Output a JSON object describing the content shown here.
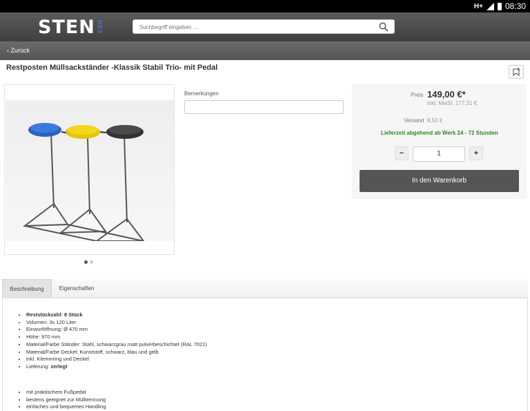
{
  "statusbar": {
    "network": "H+",
    "time": "08:30"
  },
  "header": {
    "logo": "STEN",
    "logo_sub": "HGS",
    "search_placeholder": "Suchbegriff eingeben ..."
  },
  "nav": {
    "back_label": "Zurück"
  },
  "product": {
    "title": "Restposten Müllsackständer -Klassik Stabil Trio- mit Pedal"
  },
  "form": {
    "remarks_label": "Bemerkungen",
    "remarks_value": ""
  },
  "buy": {
    "price_label": "Preis",
    "price": "149,00 €*",
    "price_net": "inkl. MwSt. 177,31 €",
    "shipping_label": "Versand",
    "shipping": "8,50 €",
    "delivery": "Lieferzeit abgehend ab Werk 24 - 72 Stunden",
    "minus": "−",
    "quantity": "1",
    "plus": "+",
    "cart_label": "In den Warenkorb"
  },
  "tabs": [
    {
      "label": "Beschreibung"
    },
    {
      "label": "Eigenschaften"
    }
  ],
  "description": {
    "list1": [
      {
        "label": "Reststückzahl: 8 Stück",
        "bold": true
      },
      {
        "label": "Volumen: 3x 120 Liter"
      },
      {
        "label": "Einwurföffnung: Ø 470 mm"
      },
      {
        "label": "Höhe: 970 mm"
      },
      {
        "label": "Material/Farbe Ständer: Stahl, schwarzgrau matt pulverbeschichtet (RAL 7021)"
      },
      {
        "label": "Material/Farbe Deckel: Kunststoff, schwarz, blau und gelb"
      },
      {
        "label": "inkl. Klemmring und Deckel"
      },
      {
        "prefix": "Lieferung: ",
        "strong": "zerlegt"
      }
    ],
    "list2": [
      {
        "label": "mit praktischem Fußpedal"
      },
      {
        "label": "bestens geeignet zur Mülltrennung"
      },
      {
        "label": "einfaches und bequemes Handling"
      }
    ]
  },
  "colors": {
    "header": "#4a4a4a",
    "accent_blue": "#3d7fd6",
    "green": "#2e8b22",
    "button": "#555555"
  }
}
